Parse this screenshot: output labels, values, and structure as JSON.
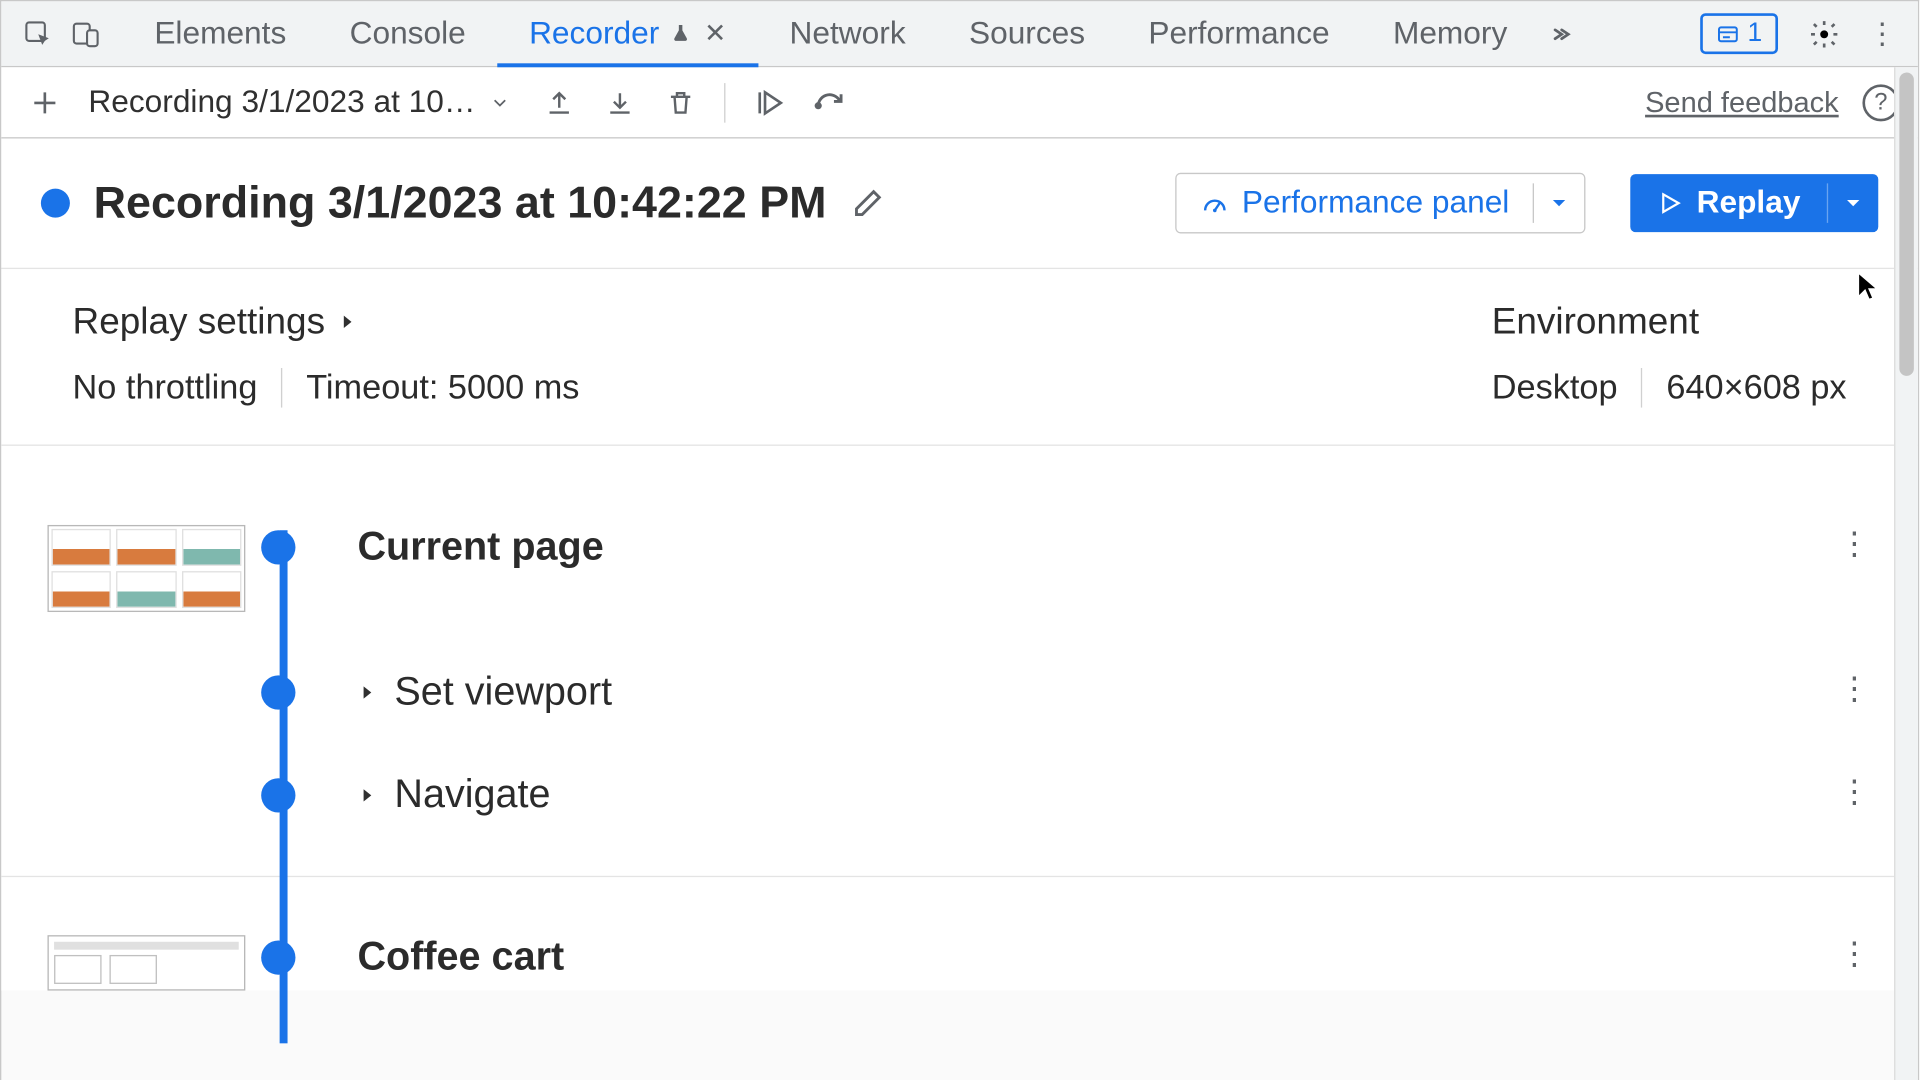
{
  "tabs": {
    "elements": "Elements",
    "console": "Console",
    "recorder": "Recorder",
    "network": "Network",
    "sources": "Sources",
    "performance": "Performance",
    "memory": "Memory"
  },
  "issues_count": "1",
  "toolbar": {
    "recording_name_short": "Recording 3/1/2023 at 10…",
    "send_feedback": "Send feedback"
  },
  "title": "Recording 3/1/2023 at 10:42:22 PM",
  "perf_panel_label": "Performance panel",
  "replay_label": "Replay",
  "replay_settings": {
    "heading": "Replay settings",
    "throttling": "No throttling",
    "timeout": "Timeout: 5000 ms"
  },
  "environment": {
    "heading": "Environment",
    "device": "Desktop",
    "viewport": "640×608 px"
  },
  "steps": {
    "current_page": "Current page",
    "set_viewport": "Set viewport",
    "navigate": "Navigate",
    "coffee_cart": "Coffee cart"
  }
}
